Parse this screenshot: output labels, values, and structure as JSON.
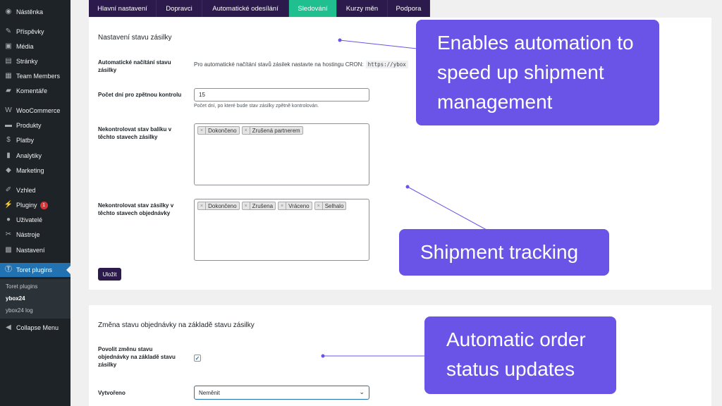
{
  "sidebar": {
    "items": [
      {
        "label": "Nástěnka",
        "icon": "dashboard-icon",
        "glyph": "◉"
      },
      {
        "label": "Příspěvky",
        "icon": "pin-icon",
        "glyph": "✎"
      },
      {
        "label": "Média",
        "icon": "media-icon",
        "glyph": "▣"
      },
      {
        "label": "Stránky",
        "icon": "pages-icon",
        "glyph": "▤"
      },
      {
        "label": "Team Members",
        "icon": "team-icon",
        "glyph": "▦"
      },
      {
        "label": "Komentáře",
        "icon": "comments-icon",
        "glyph": "▰"
      },
      {
        "label": "WooCommerce",
        "icon": "woocommerce-icon",
        "glyph": "W"
      },
      {
        "label": "Produkty",
        "icon": "products-icon",
        "glyph": "▬"
      },
      {
        "label": "Platby",
        "icon": "payments-icon",
        "glyph": "$"
      },
      {
        "label": "Analytiky",
        "icon": "analytics-icon",
        "glyph": "▮"
      },
      {
        "label": "Marketing",
        "icon": "marketing-icon",
        "glyph": "◆"
      },
      {
        "label": "Vzhled",
        "icon": "appearance-icon",
        "glyph": "✐"
      },
      {
        "label": "Pluginy",
        "icon": "plugins-icon",
        "glyph": "⚡",
        "badge": "1"
      },
      {
        "label": "Uživatelé",
        "icon": "users-icon",
        "glyph": "●"
      },
      {
        "label": "Nástroje",
        "icon": "tools-icon",
        "glyph": "✂"
      },
      {
        "label": "Nastavení",
        "icon": "settings-icon",
        "glyph": "▩"
      },
      {
        "label": "Toret plugins",
        "icon": "toret-icon",
        "glyph": "Ⓣ"
      }
    ],
    "submenu": [
      "Toret plugins",
      "ybox24",
      "ybox24 log"
    ],
    "collapse_label": "Collapse Menu"
  },
  "tabs": [
    {
      "label": "Hlavní nastavení"
    },
    {
      "label": "Dopravci"
    },
    {
      "label": "Automatické odesílání"
    },
    {
      "label": "Sledování",
      "active": true
    },
    {
      "label": "Kurzy měn"
    },
    {
      "label": "Podpora"
    }
  ],
  "tracking": {
    "title": "Nastavení stavu zásilky",
    "auto_label": "Automatické načítání stavu zásilky",
    "auto_text": "Pro automatické načítání stavů zásilek nastavte na hostingu CRON:",
    "auto_code": "https://ybox",
    "days_label": "Počet dní pro zpětnou kontrolu",
    "days_value": "15",
    "days_desc": "Počet dní, po které bude stav zásilky zpětně kontrolován.",
    "package_label": "Nekontrolovat stav balíku v těchto stavech zásilky",
    "package_tags": [
      "Dokončeno",
      "Zrušená partnerem"
    ],
    "order_label": "Nekontrolovat stav zásilky v těchto stavech objednávky",
    "order_tags": [
      "Dokončeno",
      "Zrušena",
      "Vráceno",
      "Selhalo"
    ],
    "save_label": "Uložit"
  },
  "order_status": {
    "title": "Změna stavu objednávky na základě stavu zásilky",
    "allow_label": "Povolit změnu stavu objednávky na základě stavu zásilky",
    "allow_checked": true,
    "created_label": "Vytvořeno",
    "created_value": "Neměnit"
  },
  "callouts": {
    "automation": "Enables automation to speed up shipment management",
    "tracking": "Shipment tracking",
    "status": "Automatic order status updates"
  },
  "colors": {
    "accent": "#6a54e8",
    "tab_bg": "#2c1a4d",
    "tab_active": "#1fbf8f",
    "sidebar_bg": "#1d2327",
    "sidebar_active": "#2271b1"
  }
}
